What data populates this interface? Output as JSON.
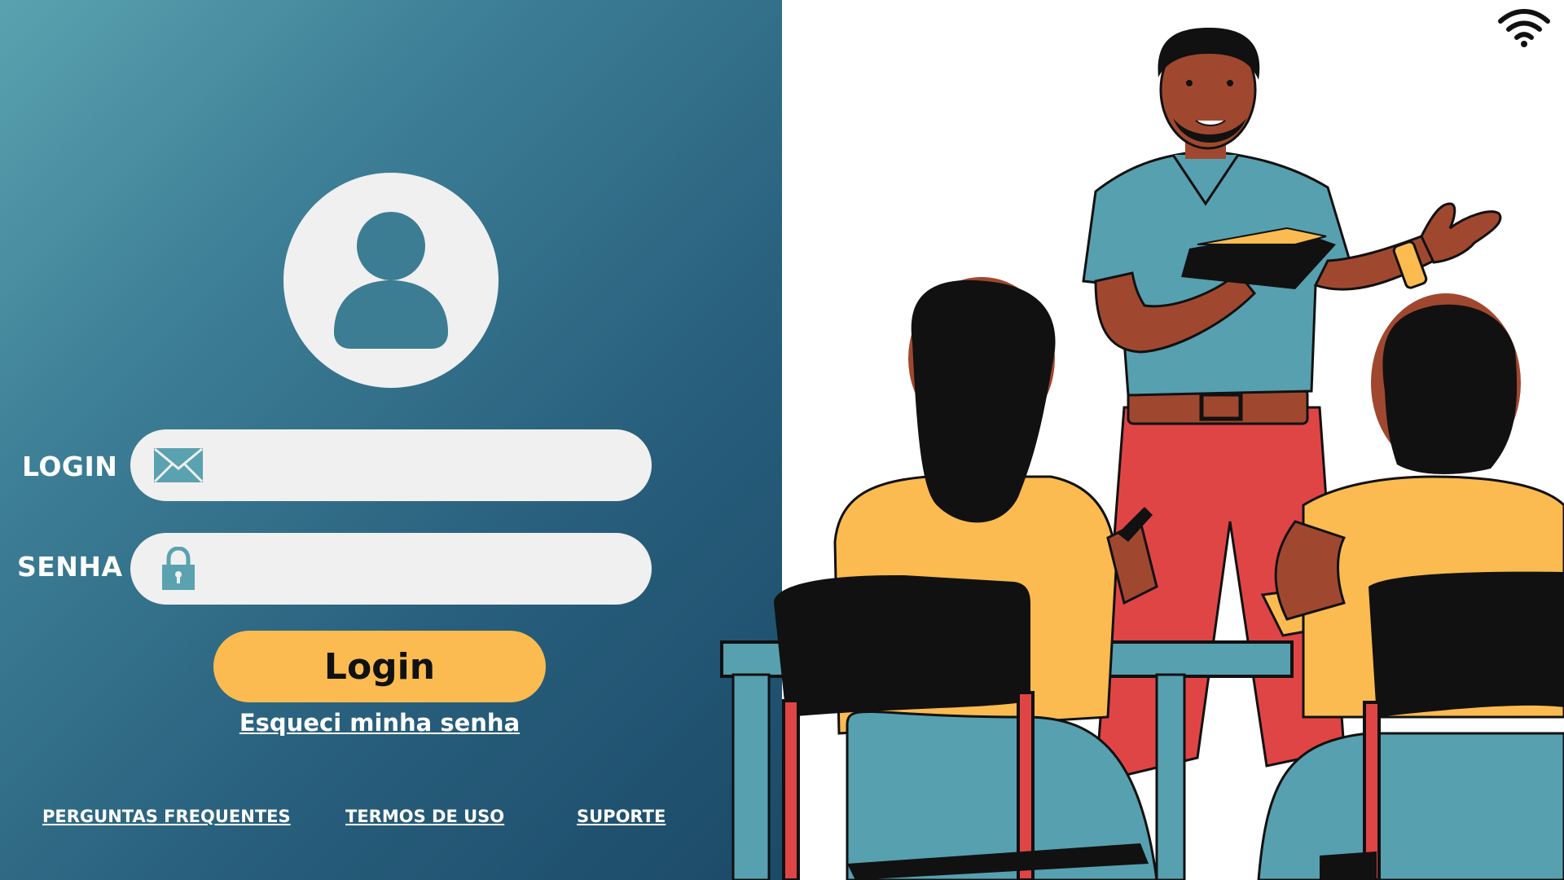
{
  "form": {
    "login_label": "LOGIN",
    "login_value": "",
    "password_label": "SENHA",
    "password_value": "",
    "submit_label": "Login",
    "forgot_label": "Esqueci minha senha"
  },
  "footer": {
    "links": [
      "PERGUNTAS FREQUENTES",
      "TERMOS DE USO",
      "SUPORTE"
    ]
  },
  "icons": {
    "avatar": "user-avatar-icon",
    "login_field": "envelope-icon",
    "password_field": "padlock-icon",
    "status": "wifi-icon"
  },
  "colors": {
    "panel_gradient_start": "#5aa2b0",
    "panel_gradient_end": "#1b4a68",
    "button": "#fbbb50",
    "field_background": "#f0f0f0"
  }
}
